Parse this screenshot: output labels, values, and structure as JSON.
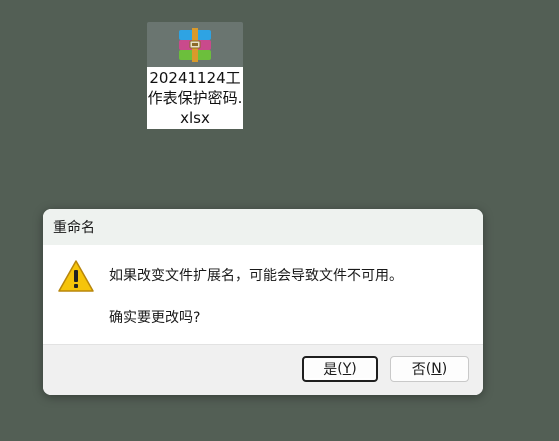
{
  "desktop": {
    "file": {
      "name": "20241124工作表保护密码.xlsx",
      "icon": "winrar-archive-icon"
    }
  },
  "dialog": {
    "title": "重命名",
    "icon": "warning-icon",
    "message_line1": "如果改变文件扩展名，可能会导致文件不可用。",
    "message_line2": "确实要更改吗?",
    "buttons": {
      "yes_label": "是",
      "yes_paren_open": "(",
      "yes_accel": "Y",
      "yes_paren_close": ")",
      "no_label": "否",
      "no_paren_open": "(",
      "no_accel": "N",
      "no_paren_close": ")"
    }
  }
}
